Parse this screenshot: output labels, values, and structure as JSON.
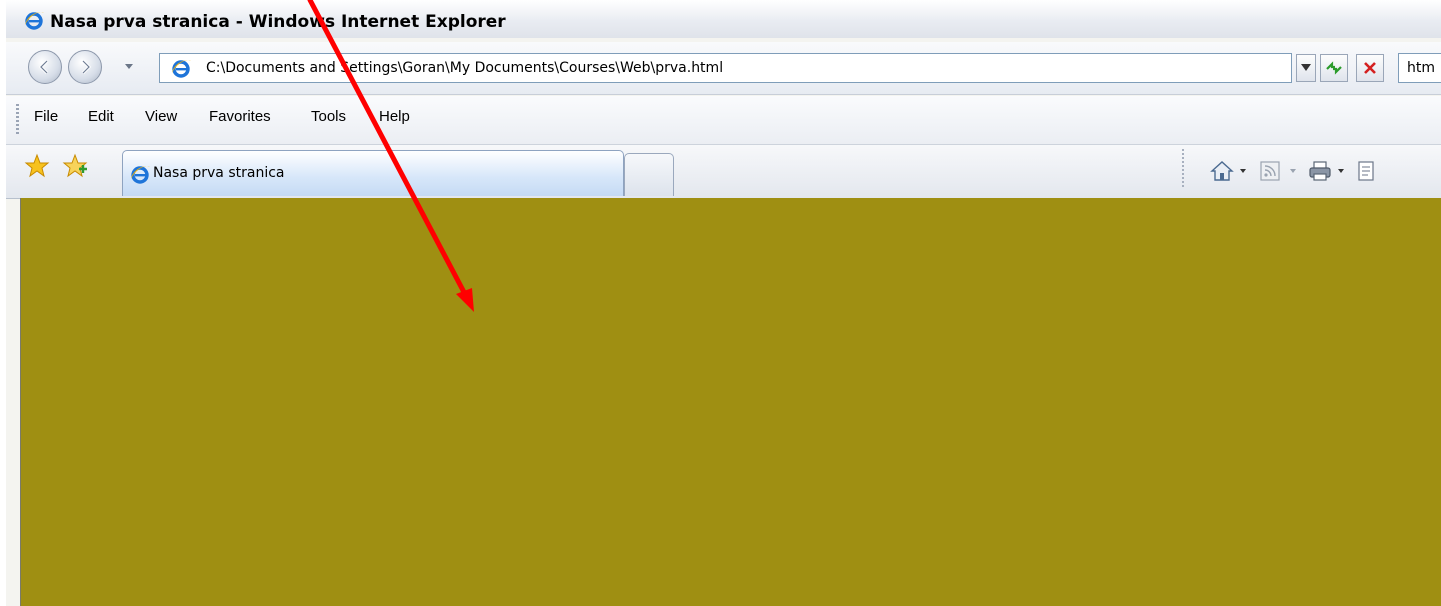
{
  "window": {
    "title": "Nasa prva stranica - Windows Internet Explorer"
  },
  "navigation": {
    "address": "C:\\Documents and Settings\\Goran\\My Documents\\Courses\\Web\\prva.html",
    "search_partial": "htm"
  },
  "menu": {
    "items": [
      "File",
      "Edit",
      "View",
      "Favorites",
      "Tools",
      "Help"
    ]
  },
  "tabs": {
    "active_label": "Nasa prva stranica"
  },
  "content": {
    "background_color": "#9f8f12"
  },
  "annotation": {
    "arrow_color": "#ff0000"
  },
  "icons": [
    "ie-logo-icon",
    "back-icon",
    "forward-icon",
    "dropdown-icon",
    "refresh-icon",
    "stop-icon",
    "star-icon",
    "add-favorite-icon",
    "home-icon",
    "feeds-icon",
    "print-icon",
    "page-icon"
  ]
}
